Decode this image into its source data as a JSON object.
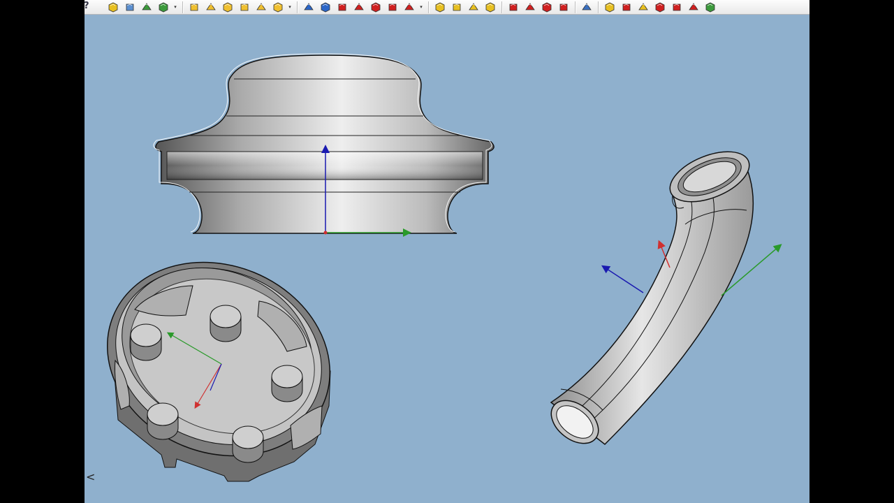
{
  "toolbar": {
    "groups": [
      {
        "name": "file",
        "icons": [
          {
            "id": "new-part-icon",
            "color": "#e8c020"
          },
          {
            "id": "open-folder-icon",
            "color": "#5b8fd0"
          },
          {
            "id": "export-icon",
            "color": "#3c9a3c"
          },
          {
            "id": "export-options-icon",
            "color": "#3c9a3c",
            "dropdown": true
          }
        ]
      },
      {
        "name": "part-design-yellow",
        "icons": [
          {
            "id": "pad-icon",
            "color": "#f0c030"
          },
          {
            "id": "revolve-icon",
            "color": "#f0c030"
          },
          {
            "id": "loft-icon",
            "color": "#f0c030"
          },
          {
            "id": "pipe-icon",
            "color": "#f0c030"
          },
          {
            "id": "helix-icon",
            "color": "#f0c030"
          },
          {
            "id": "additive-primitive-icon",
            "color": "#f0c030",
            "dropdown": true
          }
        ]
      },
      {
        "name": "part-design-subtractive",
        "icons": [
          {
            "id": "pocket-icon",
            "color": "#2b66c8"
          },
          {
            "id": "hole-icon",
            "color": "#2b66c8"
          },
          {
            "id": "groove-icon",
            "color": "#d02020"
          },
          {
            "id": "subtractive-loft-icon",
            "color": "#d02020"
          },
          {
            "id": "subtractive-pipe-icon",
            "color": "#d02020"
          },
          {
            "id": "subtractive-helix-icon",
            "color": "#d02020"
          },
          {
            "id": "subtractive-primitive-icon",
            "color": "#d02020",
            "dropdown": true
          }
        ]
      },
      {
        "name": "transform",
        "icons": [
          {
            "id": "mirror-icon",
            "color": "#e8c020"
          },
          {
            "id": "linear-pattern-icon",
            "color": "#e8c020"
          },
          {
            "id": "polar-pattern-icon",
            "color": "#e8c020"
          },
          {
            "id": "multi-transform-icon",
            "color": "#e8c020"
          }
        ]
      },
      {
        "name": "dress-up",
        "icons": [
          {
            "id": "fillet-icon",
            "color": "#d02020"
          },
          {
            "id": "chamfer-icon",
            "color": "#d02020"
          },
          {
            "id": "draft-icon",
            "color": "#d02020"
          },
          {
            "id": "thickness-icon",
            "color": "#d02020"
          }
        ]
      },
      {
        "name": "boolean",
        "icons": [
          {
            "id": "boolean-icon",
            "color": "#3a70c0"
          }
        ]
      },
      {
        "name": "sketch-tools",
        "icons": [
          {
            "id": "validate-sketch-icon",
            "color": "#e8c020"
          },
          {
            "id": "sketch-check-icon",
            "color": "#d02020"
          },
          {
            "id": "sketch-map-icon",
            "color": "#e8c020"
          },
          {
            "id": "sketch-reorient-icon",
            "color": "#d02020"
          },
          {
            "id": "sketch-merge-icon",
            "color": "#d02020"
          },
          {
            "id": "sketch-mirror-icon",
            "color": "#d02020"
          },
          {
            "id": "sketch-view-icon",
            "color": "#3c9a3c"
          }
        ]
      }
    ]
  },
  "viewport": {
    "background": "#8fb0cd",
    "axis_colors": {
      "x": "#d03030",
      "y": "#2a9a2a",
      "z": "#1a1ab0"
    }
  },
  "help_glyph": "?",
  "collapse_glyph": "<"
}
